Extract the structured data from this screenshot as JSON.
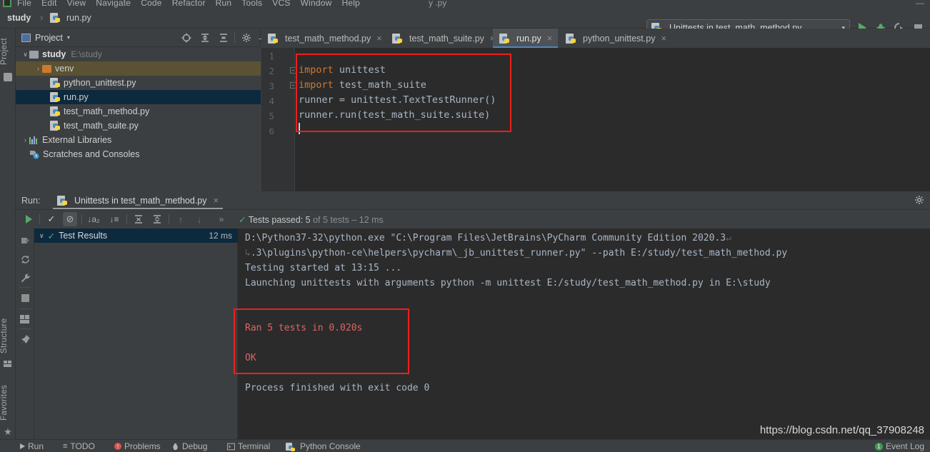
{
  "menubar": {
    "items": [
      "File",
      "Edit",
      "View",
      "Navigate",
      "Code",
      "Refactor",
      "Run",
      "Tools",
      "VCS",
      "Window",
      "Help"
    ],
    "middle": "y  .py",
    "right": "—"
  },
  "breadcrumb": {
    "project": "study",
    "separator": "›",
    "file": "run.py"
  },
  "run_widget": {
    "config_name": "Unittests in test_math_method.py",
    "caret": "▾",
    "buttons": {
      "run": "Run",
      "debug": "Debug",
      "coverage": "Run with Coverage",
      "stop": "Stop"
    }
  },
  "left_strip": {
    "project_label": "Project",
    "structure_label": "Structure",
    "favorites_label": "Favorites",
    "favorites_glyph": "★"
  },
  "project_panel": {
    "title": "Project",
    "caret": "▾",
    "icons": {
      "locate": "select-opened-file-icon",
      "expand": "expand-all-icon",
      "collapse": "collapse-all-icon",
      "settings": "gear-icon",
      "minimize": "—"
    },
    "tree": [
      {
        "label": "study",
        "path": "E:\\study",
        "type": "folder-gray",
        "arrow": "∨",
        "indent": 0,
        "bold": true,
        "state": "none"
      },
      {
        "label": "venv",
        "path": "",
        "type": "folder-orange",
        "arrow": "›",
        "indent": 1,
        "bold": false,
        "state": "olive"
      },
      {
        "label": "python_unittest.py",
        "path": "",
        "type": "python",
        "arrow": "",
        "indent": 1,
        "bold": false,
        "state": "none"
      },
      {
        "label": "run.py",
        "path": "",
        "type": "python",
        "arrow": "",
        "indent": 1,
        "bold": false,
        "state": "blue"
      },
      {
        "label": "test_math_method.py",
        "path": "",
        "type": "python",
        "arrow": "",
        "indent": 1,
        "bold": false,
        "state": "none"
      },
      {
        "label": "test_math_suite.py",
        "path": "",
        "type": "python",
        "arrow": "",
        "indent": 1,
        "bold": false,
        "state": "none"
      },
      {
        "label": "External Libraries",
        "path": "",
        "type": "library",
        "arrow": "›",
        "indent": 0,
        "bold": false,
        "state": "none"
      },
      {
        "label": "Scratches and Consoles",
        "path": "",
        "type": "scratch",
        "arrow": "",
        "indent": 0,
        "bold": false,
        "state": "none"
      }
    ]
  },
  "editor": {
    "tabs": [
      {
        "label": "test_math_method.py",
        "active": false,
        "close": "×"
      },
      {
        "label": "test_math_suite.py",
        "active": false,
        "close": "×"
      },
      {
        "label": "run.py",
        "active": true,
        "close": "×"
      },
      {
        "label": "python_unittest.py",
        "active": false,
        "close": "×"
      }
    ],
    "line_numbers": [
      "1",
      "2",
      "3",
      "4",
      "5",
      "6"
    ],
    "fold_marker": "−",
    "code_lines": [
      {
        "n": 1,
        "tokens": []
      },
      {
        "n": 2,
        "tokens": [
          {
            "t": "import",
            "c": "kw"
          },
          {
            "t": " unittest",
            "c": "pl"
          }
        ]
      },
      {
        "n": 3,
        "tokens": [
          {
            "t": "import",
            "c": "kw"
          },
          {
            "t": " test_math_suite",
            "c": "pl"
          }
        ]
      },
      {
        "n": 4,
        "tokens": [
          {
            "t": "runner = unittest.TextTestRunner()",
            "c": "pl"
          }
        ]
      },
      {
        "n": 5,
        "tokens": [
          {
            "t": "runner.run(test_math_suite.suite)",
            "c": "pl"
          }
        ]
      },
      {
        "n": 6,
        "tokens": []
      }
    ]
  },
  "run_window": {
    "label": "Run:",
    "tab_title": "Unittests in test_math_method.py",
    "tab_close": "×",
    "gear": "gear-icon",
    "toolbar": [
      {
        "name": "rerun-tests-button",
        "glyph": "▶"
      },
      {
        "name": "show-passed-toggle",
        "glyph": "✓"
      },
      {
        "name": "show-ignored-toggle",
        "glyph": "⊘"
      },
      {
        "name": "sort-alphabetically-button",
        "glyph": "↓a₂"
      },
      {
        "name": "sort-by-duration-button",
        "glyph": "↓≡"
      },
      {
        "name": "expand-all-button",
        "glyph": "⤓"
      },
      {
        "name": "collapse-all-button",
        "glyph": "⤒"
      },
      {
        "name": "previous-failed-button",
        "glyph": "↑"
      },
      {
        "name": "next-failed-button",
        "glyph": "↓"
      },
      {
        "name": "more-options-button",
        "glyph": "»"
      }
    ],
    "status": {
      "check": "✓",
      "label": "Tests passed:",
      "count": "5",
      "of_text": "of 5 tests",
      "dash": "–",
      "duration": "12 ms"
    },
    "side_icons": [
      {
        "name": "rerun-failed-tests-icon",
        "glyph": "➤"
      },
      {
        "name": "rerun-automatically-icon",
        "glyph": "↺"
      },
      {
        "name": "test-settings-icon",
        "glyph": "🔧"
      },
      {
        "name": "stop-icon",
        "glyph": "■"
      },
      {
        "name": "layout-settings-icon",
        "glyph": "⬛"
      },
      {
        "name": "pin-tab-icon",
        "glyph": "📌"
      }
    ],
    "test_tree": {
      "arrow": "∨",
      "check": "✓",
      "label": "Test Results",
      "duration": "12 ms"
    },
    "console_lines": [
      {
        "text": "D:\\Python37-32\\python.exe \"C:\\Program Files\\JetBrains\\PyCharm Community Edition 2020.3",
        "wrap_start": "",
        "wrap_end": "↵",
        "color": "normal"
      },
      {
        "text": ".3\\plugins\\python-ce\\helpers\\pycharm\\_jb_unittest_runner.py\" --path E:/study/test_math_method.py",
        "wrap_start": "↳",
        "wrap_end": "",
        "color": "normal"
      },
      {
        "text": "Testing started at 13:15 ...",
        "wrap_start": "",
        "wrap_end": "",
        "color": "normal"
      },
      {
        "text": "Launching unittests with arguments python -m unittest E:/study/test_math_method.py in E:\\study",
        "wrap_start": "",
        "wrap_end": "",
        "color": "normal"
      },
      {
        "text": "Ran 5 tests in 0.020s",
        "wrap_start": "",
        "wrap_end": "",
        "color": "red"
      },
      {
        "text": "OK",
        "wrap_start": "",
        "wrap_end": "",
        "color": "red"
      },
      {
        "text": "Process finished with exit code 0",
        "wrap_start": "",
        "wrap_end": "",
        "color": "normal"
      }
    ]
  },
  "status_bar": {
    "run": "Run",
    "todo": "TODO",
    "problems": "Problems",
    "debug": "Debug",
    "terminal": "Terminal",
    "python_console": "Python Console",
    "event_log": "Event Log",
    "event_log_count": "1"
  },
  "watermark": "https://blog.csdn.net/qq_37908248",
  "colors": {
    "accent_blue": "#4a88c7",
    "selection_blue": "#0d293e",
    "selection_olive": "#5a5233",
    "pass_green": "#59a869",
    "keyword_orange": "#cc7832",
    "highlight_red": "#f01e1e",
    "output_red": "#e36262"
  }
}
